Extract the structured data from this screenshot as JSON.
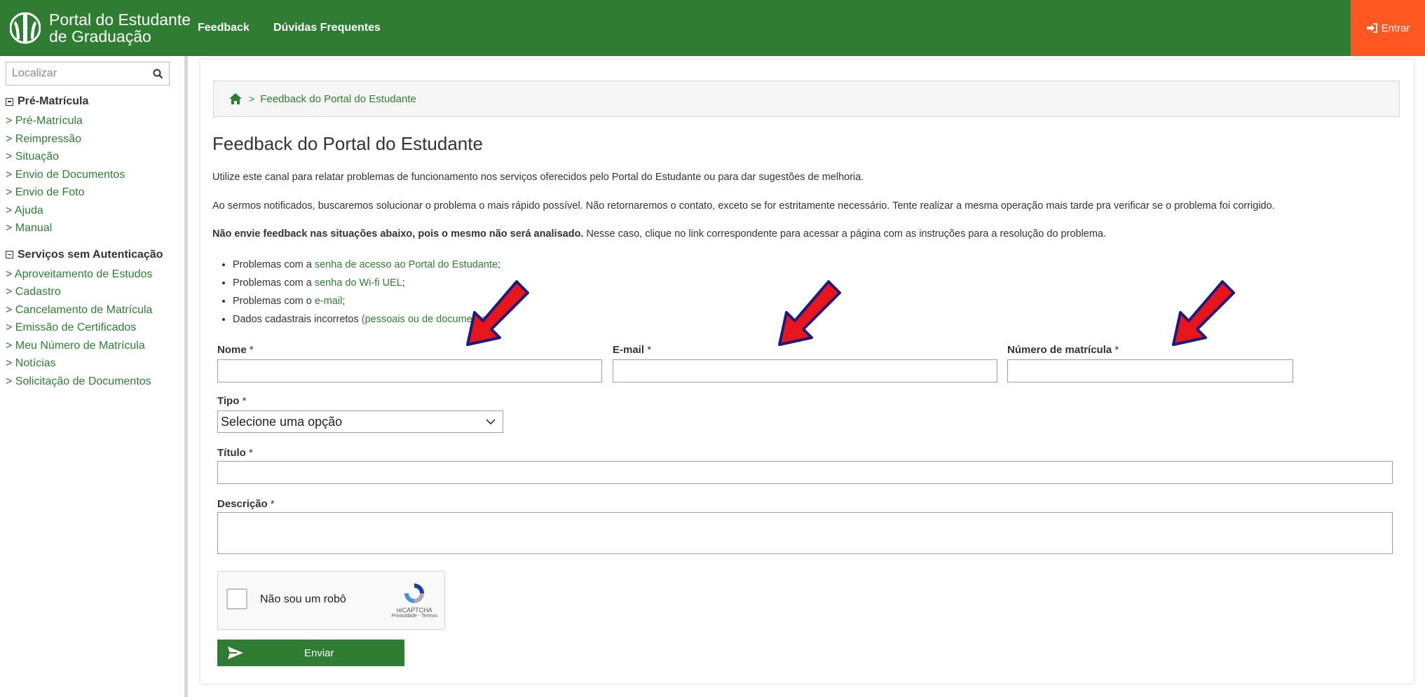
{
  "header": {
    "brand_line1": "Portal do Estudante",
    "brand_line2": "de Graduação",
    "nav": [
      "Feedback",
      "Dúvidas Frequentes"
    ],
    "login_label": "Entrar",
    "bg_color": "#2e7d32",
    "login_color": "#ff5722"
  },
  "sidebar": {
    "search_placeholder": "Localizar",
    "sections": [
      {
        "heading": "Pré-Matrícula",
        "items": [
          "> Pré-Matrícula",
          "> Reimpressão",
          "> Situação",
          "> Envio de Documentos",
          "> Envio de Foto",
          "> Ajuda",
          "> Manual"
        ]
      },
      {
        "heading": "Serviços sem Autenticação",
        "items": [
          "> Aproveitamento de Estudos",
          "> Cadastro",
          "> Cancelamento de Matrícula",
          "> Emissão de Certificados",
          "> Meu Número de Matrícula",
          "> Notícias",
          "> Solicitação de Documentos"
        ]
      }
    ]
  },
  "breadcrumb": {
    "current": "Feedback do Portal do Estudante"
  },
  "page": {
    "title": "Feedback do Portal do Estudante",
    "intro": "Utilize este canal para relatar problemas de funcionamento nos serviços oferecidos pelo Portal do Estudante ou para dar sugestões de melhoria.",
    "notice": "Ao sermos notificados, buscaremos solucionar o problema o mais rápido possível. Não retornaremos o contato, exceto se for estritamente necessário. Tente realizar a mesma operação mais tarde pra verificar se o problema foi corrigido.",
    "warning_bold": "Não envie feedback nas situações abaixo, pois o mesmo não será analisado.",
    "warning_rest": " Nesse caso, clique no link correspondente para acessar a página com as instruções para a resolução do problema.",
    "bullets": [
      {
        "prefix": "Problemas com a ",
        "link": "senha de acesso ao Portal do Estudante",
        "suffix": ";"
      },
      {
        "prefix": "Problemas com a ",
        "link": "senha do Wi-fi UEL",
        "suffix": ";"
      },
      {
        "prefix": "Problemas com o ",
        "link": "e-mail",
        "suffix": ";"
      },
      {
        "prefix": "Dados cadastrais incorretos ",
        "link": "(pessoais ou de documentos)",
        "suffix": "."
      }
    ]
  },
  "form": {
    "name_label": "Nome",
    "email_label": "E-mail",
    "matricula_label": "Número de matrícula",
    "tipo_label": "Tipo",
    "tipo_value": "Selecione uma opção",
    "titulo_label": "Título",
    "descricao_label": "Descrição",
    "required_mark": "*",
    "captcha_label": "Não sou um robô",
    "captcha_brand": "reCAPTCHA",
    "captcha_links": "Privacidade - Termos",
    "submit_label": "Enviar"
  }
}
